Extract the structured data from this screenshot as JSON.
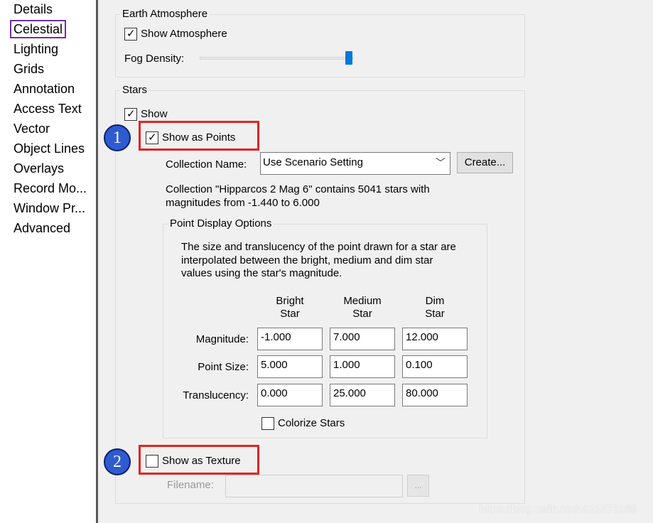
{
  "nav": {
    "items": [
      {
        "label": "Details"
      },
      {
        "label": "Celestial",
        "selected": true
      },
      {
        "label": "Lighting"
      },
      {
        "label": "Grids"
      },
      {
        "label": "Annotation"
      },
      {
        "label": "Access Text"
      },
      {
        "label": "Vector"
      },
      {
        "label": "Object Lines"
      },
      {
        "label": "Overlays"
      },
      {
        "label": "Record Mo..."
      },
      {
        "label": "Window Pr..."
      },
      {
        "label": "Advanced"
      }
    ],
    "selected_outline_color": "#7030a0"
  },
  "earth_atmosphere": {
    "title": "Earth Atmosphere",
    "show_atmosphere_label": "Show Atmosphere",
    "show_atmosphere_checked": true,
    "fog_density_label": "Fog Density:",
    "fog_density_level": 1.0
  },
  "stars": {
    "title": "Stars",
    "show_label": "Show",
    "show_checked": true,
    "show_as_points_label": "Show as Points",
    "show_as_points_checked": true,
    "collection_name_label": "Collection Name:",
    "collection_name_value": "Use Scenario Setting",
    "create_button_label": "Create...",
    "collection_info_line1": "Collection \"Hipparcos 2 Mag 6\" contains 5041 stars with",
    "collection_info_line2": "magnitudes from -1.440 to 6.000",
    "point_display": {
      "title": "Point Display Options",
      "description_line1": "The size and translucency of the point drawn for a star are",
      "description_line2": "interpolated between the bright, medium and dim star",
      "description_line3": "values using the star's magnitude.",
      "columns": [
        {
          "line1": "Bright",
          "line2": "Star"
        },
        {
          "line1": "Medium",
          "line2": "Star"
        },
        {
          "line1": "Dim",
          "line2": "Star"
        }
      ],
      "rows": [
        {
          "label": "Magnitude:",
          "values": [
            "-1.000",
            "7.000",
            "12.000"
          ]
        },
        {
          "label": "Point Size:",
          "values": [
            "5.000",
            "1.000",
            "0.100"
          ]
        },
        {
          "label": "Translucency:",
          "values": [
            "0.000",
            "25.000",
            "80.000"
          ]
        }
      ],
      "colorize_stars_label": "Colorize Stars",
      "colorize_stars_checked": false
    },
    "show_as_texture_label": "Show as Texture",
    "show_as_texture_checked": false,
    "filename_label": "Filename:",
    "filename_value": "",
    "browse_button_label": "..."
  },
  "callouts": [
    {
      "number": "1"
    },
    {
      "number": "2"
    }
  ],
  "colors": {
    "callout_border": "#e02424",
    "badge_fill": "#2e5bd0",
    "slider_thumb": "#0078d7"
  },
  "watermark": "https://blog.csdn.net/u011575168"
}
